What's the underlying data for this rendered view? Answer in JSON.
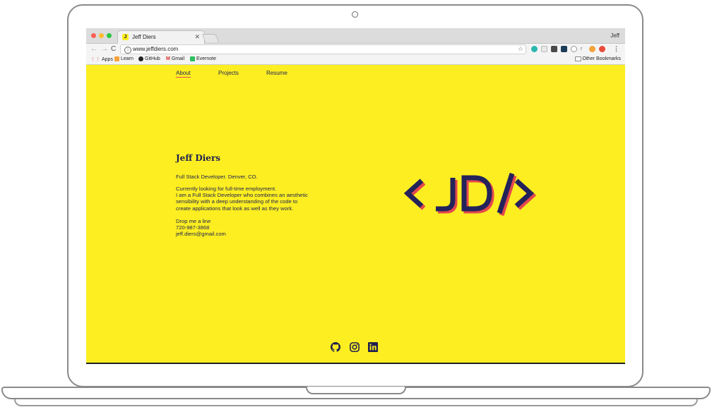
{
  "browser": {
    "tab_title": "Jeff Diers",
    "tab_favicon_letter": "J",
    "profile_name": "Jeff",
    "url": "www.jeffdiers.com",
    "bookmarks": [
      "Apps",
      "Learn",
      "GitHub",
      "Gmail",
      "Evernote"
    ],
    "other_bookmarks": "Other Bookmarks"
  },
  "nav": {
    "about": "About",
    "projects": "Projects",
    "resume": "Resume"
  },
  "profile": {
    "name": "Jeff Diers",
    "tagline": "Full Stack Developer. Denver, CO.",
    "bio_line1": "Currently looking for full-time employment.",
    "bio_line2": "I am a Full Stack Developer who combines an aesthetic",
    "bio_line3": "sensibility with a deep understanding of the code to",
    "bio_line4": "create applications that look as well as they work.",
    "contact_heading": "Drop me a line",
    "phone": "720-987-3868",
    "email": "jeff.diers@gmail.com"
  },
  "logo_text": "<JD/>",
  "social_icons": [
    "github-icon",
    "instagram-icon",
    "linkedin-icon"
  ],
  "colors": {
    "page_background": "#fcee21",
    "primary_text": "#1f2050",
    "accent": "#e5484d"
  }
}
